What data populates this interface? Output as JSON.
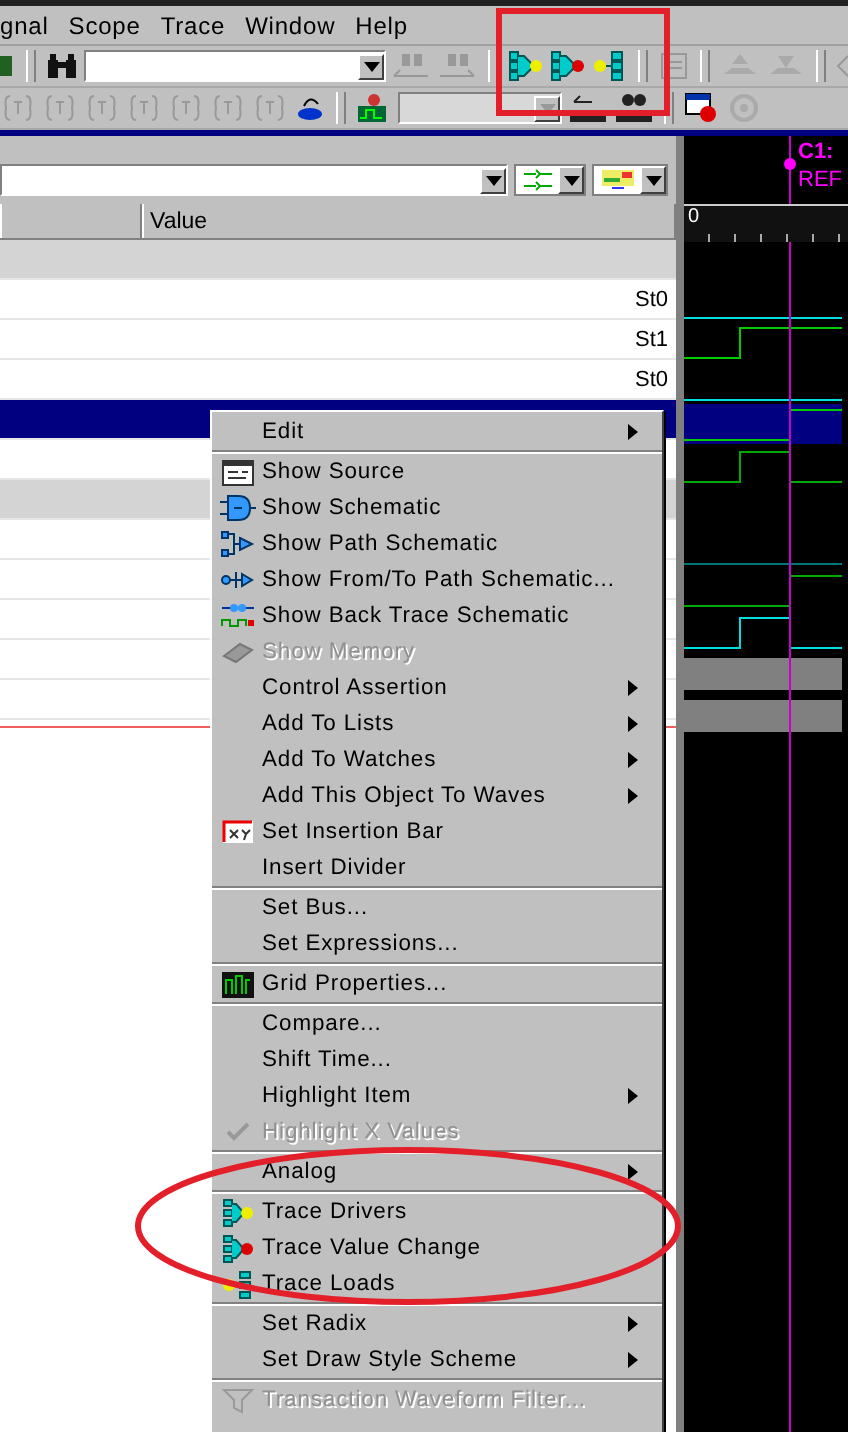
{
  "menu_bar": [
    "gnal",
    "Scope",
    "Trace",
    "Window",
    "Help"
  ],
  "object_pane": {
    "value_header": "Value",
    "rows": [
      {
        "kind": "group",
        "selected": false
      },
      {
        "kind": "signal",
        "value": "St0",
        "selected": false
      },
      {
        "kind": "signal",
        "value": "St1",
        "selected": false
      },
      {
        "kind": "signal",
        "value": "St0",
        "selected": false
      },
      {
        "kind": "signal",
        "selected": true
      },
      {
        "kind": "signal",
        "selected": false
      },
      {
        "kind": "group",
        "selected": false
      },
      {
        "kind": "signal",
        "selected": false
      },
      {
        "kind": "signal",
        "selected": false
      },
      {
        "kind": "signal",
        "selected": false
      },
      {
        "kind": "signal",
        "selected": false
      },
      {
        "kind": "signal",
        "selected": false
      }
    ]
  },
  "waveform": {
    "cursor": "C1:",
    "reference": "REF",
    "ruler_start": "0"
  },
  "context_menu": {
    "sections": [
      [
        {
          "label": "Edit",
          "submenu": true,
          "disabled": false,
          "checked": false
        }
      ],
      [
        {
          "label": "Show Source",
          "submenu": false,
          "disabled": false,
          "checked": false
        },
        {
          "label": "Show Schematic",
          "submenu": false,
          "disabled": false,
          "checked": false
        },
        {
          "label": "Show Path Schematic",
          "submenu": false,
          "disabled": false,
          "checked": false
        },
        {
          "label": "Show From/To Path Schematic...",
          "submenu": false,
          "disabled": false,
          "checked": false
        },
        {
          "label": "Show Back Trace Schematic",
          "submenu": false,
          "disabled": false,
          "checked": false
        },
        {
          "label": "Show Memory",
          "submenu": false,
          "disabled": true,
          "checked": false
        },
        {
          "label": "Control Assertion",
          "submenu": true,
          "disabled": false,
          "checked": false
        },
        {
          "label": "Add To Lists",
          "submenu": true,
          "disabled": false,
          "checked": false
        },
        {
          "label": "Add To Watches",
          "submenu": true,
          "disabled": false,
          "checked": false
        },
        {
          "label": "Add This Object To Waves",
          "submenu": true,
          "disabled": false,
          "checked": false
        },
        {
          "label": "Set Insertion Bar",
          "submenu": false,
          "disabled": false,
          "checked": false
        },
        {
          "label": "Insert Divider",
          "submenu": false,
          "disabled": false,
          "checked": false
        }
      ],
      [
        {
          "label": "Set Bus...",
          "submenu": false,
          "disabled": false,
          "checked": false
        },
        {
          "label": "Set Expressions...",
          "submenu": false,
          "disabled": false,
          "checked": false
        }
      ],
      [
        {
          "label": "Grid Properties...",
          "submenu": false,
          "disabled": false,
          "checked": false
        }
      ],
      [
        {
          "label": "Compare...",
          "submenu": false,
          "disabled": false,
          "checked": false
        },
        {
          "label": "Shift Time...",
          "submenu": false,
          "disabled": false,
          "checked": false
        },
        {
          "label": "Highlight Item",
          "submenu": true,
          "disabled": false,
          "checked": false
        },
        {
          "label": "Highlight X Values",
          "submenu": false,
          "disabled": true,
          "checked": true
        }
      ],
      [
        {
          "label": "Analog",
          "submenu": true,
          "disabled": false,
          "checked": false
        }
      ],
      [
        {
          "label": "Trace Drivers",
          "submenu": false,
          "disabled": false,
          "checked": false
        },
        {
          "label": "Trace Value Change",
          "submenu": false,
          "disabled": false,
          "checked": false
        },
        {
          "label": "Trace Loads",
          "submenu": false,
          "disabled": false,
          "checked": false
        }
      ],
      [
        {
          "label": "Set Radix",
          "submenu": true,
          "disabled": false,
          "checked": false
        },
        {
          "label": "Set Draw Style Scheme",
          "submenu": true,
          "disabled": false,
          "checked": false
        }
      ],
      [
        {
          "label": "Transaction Waveform Filter...",
          "submenu": false,
          "disabled": true,
          "checked": false
        }
      ]
    ]
  }
}
